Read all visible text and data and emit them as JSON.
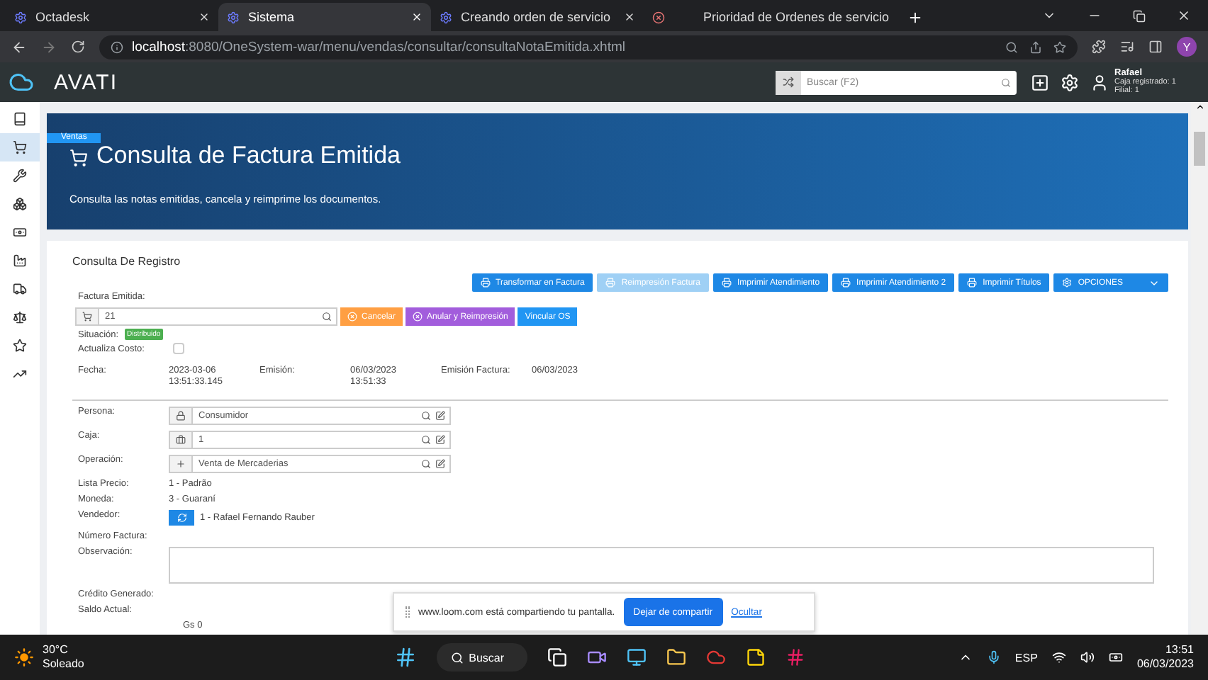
{
  "browser": {
    "tabs": [
      {
        "kind": "text",
        "label": "Octadesk",
        "selected": false
      },
      {
        "kind": "text",
        "label": "Sistema",
        "selected": true
      },
      {
        "kind": "text",
        "label": "Creando orden de servicio",
        "selected": false
      },
      {
        "kind": "icon",
        "selected": false
      },
      {
        "kind": "text",
        "label": "Prioridad de Ordenes de servicio",
        "selected": false
      }
    ],
    "address_host": "localhost",
    "address_path": ":8080/OneSystem-war/menu/vendas/consultar/consultaNotaEmitida.xhtml",
    "profile": "Y"
  },
  "app_header": {
    "logo": "AVATI",
    "search_placeholder": "Buscar (F2)",
    "user": "Rafael",
    "user_lines": [
      "Caja registrado: 1",
      "Filial: 1"
    ]
  },
  "sidebar": {
    "items": [
      {
        "selected": false
      },
      {
        "selected": true
      },
      {
        "selected": false
      },
      {
        "selected": false
      },
      {
        "selected": false
      },
      {
        "selected": false
      },
      {
        "selected": false
      },
      {
        "selected": false
      },
      {
        "selected": false
      },
      {
        "selected": false
      }
    ],
    "tooltip": "Ventas"
  },
  "banner": {
    "title": "Consulta de Factura Emitida",
    "subtitle": "Consulta las notas emitidas, cancela y reimprime los documentos."
  },
  "card": {
    "title": "Consulta De Registro",
    "toolbar": [
      {
        "label": "Transformar en Factura",
        "disabled": false,
        "kind": "print"
      },
      {
        "label": "Reimpresión Factura",
        "disabled": true,
        "kind": "print"
      },
      {
        "label": "Imprimir Atendimiento",
        "disabled": false,
        "kind": "print"
      },
      {
        "label": "Imprimir Atendimiento 2",
        "disabled": false,
        "kind": "print"
      },
      {
        "label": "Imprimir Títulos",
        "disabled": false,
        "kind": "print"
      },
      {
        "label": "OPCIONES",
        "disabled": false,
        "kind": "menu"
      }
    ],
    "invoice_label": "Factura Emitida:",
    "invoice_value": "21",
    "actions": [
      {
        "label": "Cancelar",
        "kind": "warning"
      },
      {
        "label": "Anular y Reimpresión",
        "kind": "danger"
      },
      {
        "label": "Vincular OS",
        "kind": "info"
      }
    ],
    "situation_label": "Situación:",
    "situation_badge": "Distribuido",
    "update_cost_label": "Actualiza Costo:",
    "update_cost_checked": false,
    "dates": [
      {
        "label": "Fecha:",
        "value": "2023-03-06 13:51:33.145"
      },
      {
        "label": "Emisión:",
        "value": "06/03/2023 13:51:33"
      },
      {
        "label": "Emisión Factura:",
        "value": "06/03/2023"
      }
    ],
    "fields": [
      {
        "kind": "lookup",
        "label": "Persona:",
        "value": "Consumidor"
      },
      {
        "kind": "lookup",
        "label": "Caja:",
        "value": "1"
      },
      {
        "kind": "lookup",
        "label": "Operación:",
        "value": "Venta de Mercaderias"
      },
      {
        "kind": "text",
        "label": "Lista Precio:",
        "value": "1 - Padrão"
      },
      {
        "kind": "text",
        "label": "Moneda:",
        "value": "3 - Guaraní"
      },
      {
        "kind": "seller",
        "label": "Vendedor:",
        "value": "1 - Rafael Fernando Rauber"
      },
      {
        "kind": "text",
        "label": "Número Factura:"
      },
      {
        "kind": "textarea",
        "label": "Observación:"
      },
      {
        "kind": "text",
        "label": "Crédito Generado:"
      },
      {
        "kind": "text",
        "label": "Saldo Actual:"
      },
      {
        "kind": "amount",
        "value": "Gs 0"
      }
    ]
  },
  "share_bar": {
    "message": "www.loom.com está compartiendo tu pantalla.",
    "stop_button": "Dejar de compartir",
    "hide_link": "Ocultar"
  },
  "taskbar": {
    "temperature": "30°C",
    "weather": "Soleado",
    "search": "Buscar",
    "language": "ESP",
    "time": "13:51",
    "date": "06/03/2023"
  }
}
